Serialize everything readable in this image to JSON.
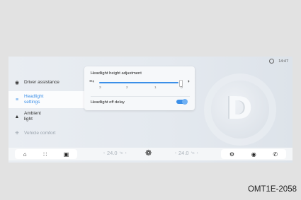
{
  "status": {
    "time": "14:47"
  },
  "sidebar": {
    "items": [
      {
        "label_line1": "Driver assistance",
        "label_line2": "",
        "icon": "steering-wheel-icon",
        "state": "normal"
      },
      {
        "label_line1": "Headlight",
        "label_line2": "settings",
        "icon": "headlight-icon",
        "state": "active"
      },
      {
        "label_line1": "Ambient",
        "label_line2": "light",
        "icon": "ambient-light-icon",
        "state": "normal"
      },
      {
        "label_line1": "Vehicle comfort",
        "label_line2": "",
        "icon": "seat-icon",
        "state": "muted"
      }
    ]
  },
  "panel": {
    "height_title": "Headlight height adjustment",
    "height_level": 0,
    "height_ticks": [
      "3",
      "2",
      "1",
      "0"
    ],
    "off_delay_label": "Headlight off delay",
    "off_delay_enabled": true
  },
  "dock": {
    "left_icons": [
      "home-icon",
      "apps-grid-icon",
      "car-icon"
    ],
    "left_temp": "24.0",
    "right_temp": "24.0",
    "temp_unit": "°C",
    "fan_icon": "fan-icon",
    "right_icons": [
      "settings-icon",
      "camera-icon",
      "phone-icon"
    ]
  },
  "caption": "OMT1E-2058",
  "colors": {
    "accent": "#3b8fe8",
    "background": "#e2e2e2"
  }
}
